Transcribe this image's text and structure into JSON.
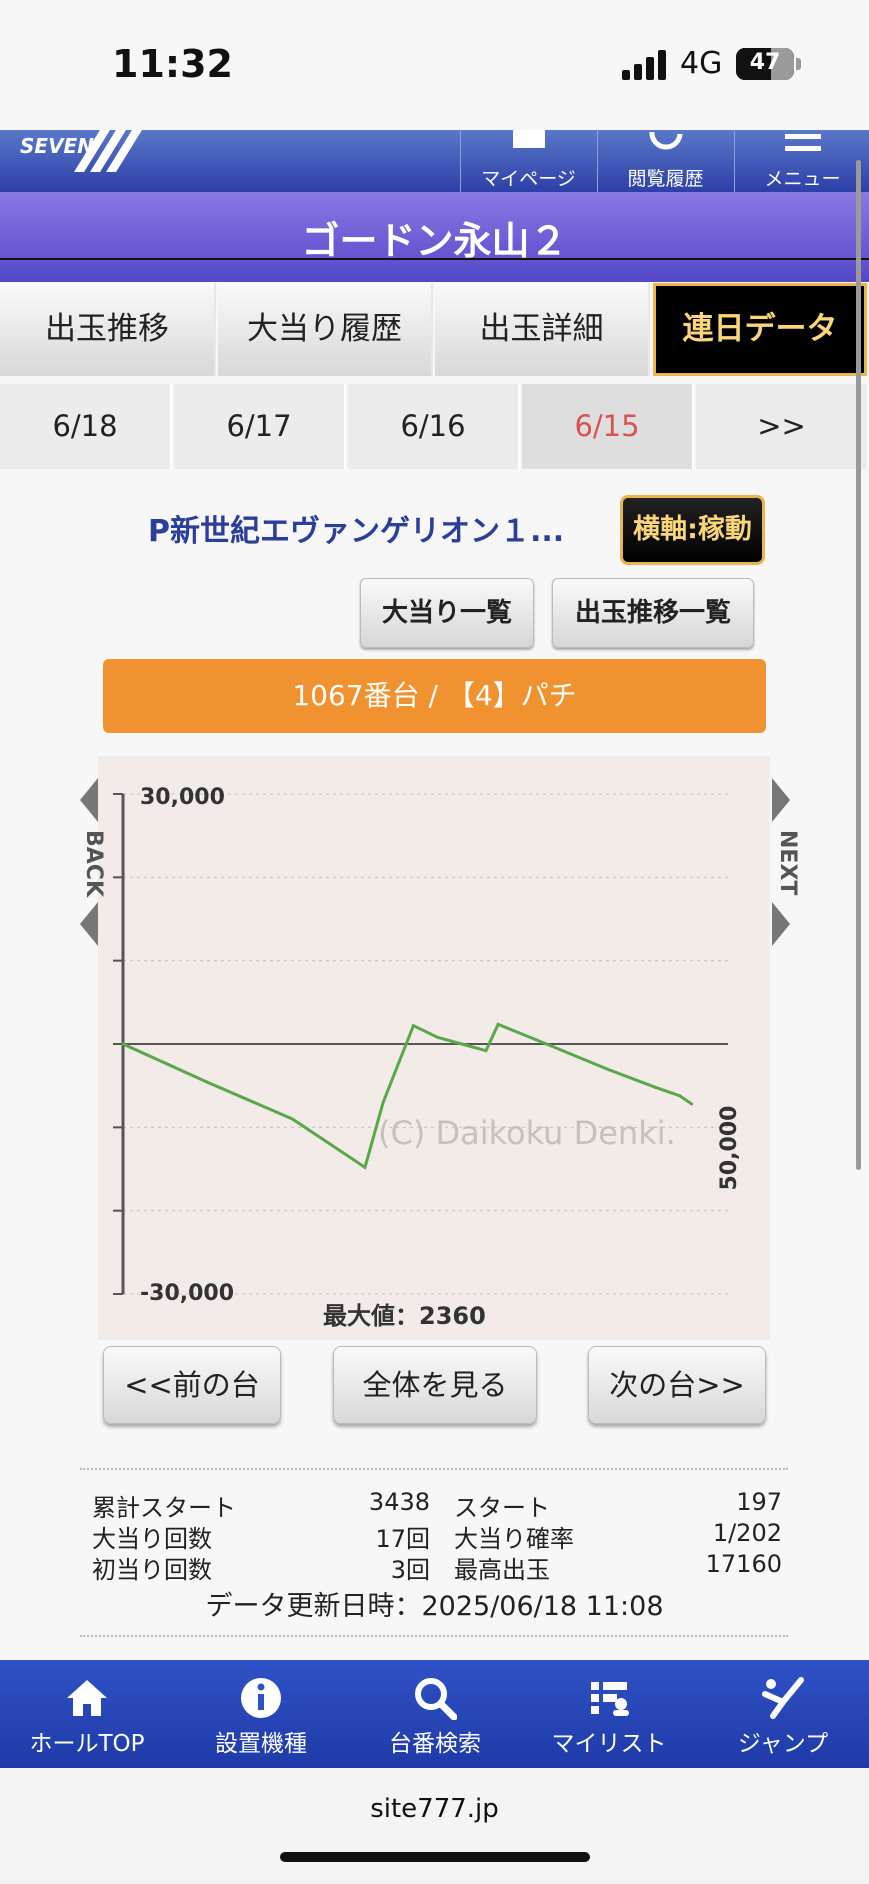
{
  "status_bar": {
    "time": "11:32",
    "network": "4G",
    "battery": "47"
  },
  "header": {
    "logo_text": "SEVEN",
    "nav": [
      {
        "label": "マイページ",
        "icon": "mypage-icon"
      },
      {
        "label": "閲覧履歴",
        "icon": "history-icon"
      },
      {
        "label": "メニュー",
        "icon": "menu-icon"
      }
    ]
  },
  "title": "ゴードン永山２",
  "tabs": [
    {
      "label": "出玉推移",
      "active": false
    },
    {
      "label": "大当り履歴",
      "active": false
    },
    {
      "label": "出玉詳細",
      "active": false
    },
    {
      "label": "連日データ",
      "active": true
    }
  ],
  "dates": [
    {
      "label": "6/18",
      "selected": false
    },
    {
      "label": "6/17",
      "selected": false
    },
    {
      "label": "6/16",
      "selected": false
    },
    {
      "label": "6/15",
      "selected": true
    },
    {
      "label": ">>",
      "selected": false
    }
  ],
  "machine": {
    "name": "P新世紀エヴァンゲリオン１...",
    "axis_button": "横軸:稼動",
    "list_buttons": [
      "大当り一覧",
      "出玉推移一覧"
    ],
    "unit_banner": "1067番台 / 【4】パチ"
  },
  "chart_data": {
    "type": "line",
    "back_label": "BACK",
    "next_label": "NEXT",
    "y_tick_labels": [
      "30,000",
      "-30,000"
    ],
    "ylim": [
      -30000,
      30000
    ],
    "y_ticks": [
      30000,
      20000,
      10000,
      0,
      -10000,
      -20000,
      -30000
    ],
    "x_end_label": "50,000",
    "xlim": [
      0,
      50000
    ],
    "watermark": "(C) Daikoku Denki.",
    "max_label": "最大値：2360",
    "series": [
      {
        "color": "#5aa84a",
        "x": [
          0,
          7000,
          14000,
          20000,
          21500,
          24000,
          26000,
          28000,
          30000,
          31000,
          35000,
          40000,
          44000,
          46000,
          47000
        ],
        "y": [
          0,
          -4600,
          -9000,
          -14800,
          -7000,
          2200,
          800,
          0,
          -800,
          2360,
          0,
          -3000,
          -5200,
          -6200,
          -7200
        ]
      }
    ]
  },
  "nav_buttons": {
    "prev": "<<前の台",
    "all": "全体を見る",
    "next": "次の台>>"
  },
  "stats": [
    {
      "k1": "累計スタート",
      "v1": "3438",
      "k2": "スタート",
      "v2": "197"
    },
    {
      "k1": "大当り回数",
      "v1": "17回",
      "k2": "大当り確率",
      "v2": "1/202"
    },
    {
      "k1": "初当り回数",
      "v1": "3回",
      "k2": "最高出玉",
      "v2": "17160"
    }
  ],
  "updated": "データ更新日時：2025/06/18 11:08",
  "bottom_nav": [
    {
      "label": "ホールTOP",
      "icon": "home-icon"
    },
    {
      "label": "設置機種",
      "icon": "info-icon"
    },
    {
      "label": "台番検索",
      "icon": "search-icon"
    },
    {
      "label": "マイリスト",
      "icon": "mylist-icon"
    },
    {
      "label": "ジャンプ",
      "icon": "jump-icon"
    }
  ],
  "url": "site777.jp"
}
